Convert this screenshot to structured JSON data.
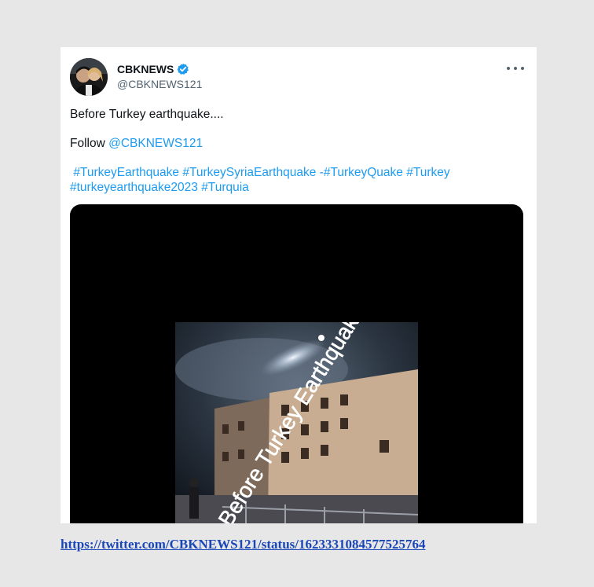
{
  "tweet": {
    "display_name": "CBKNEWS",
    "handle": "@CBKNEWS121",
    "verified_color": "#1d9bf0",
    "text_line1": "Before Turkey earthquake....",
    "follow_prefix": "Follow ",
    "follow_mention": "@CBKNEWS121",
    "hashtags": [
      "#TurkeyEarthquake",
      "#TurkeySyriaEarthquake",
      "#TurkeyQuake",
      "#Turkey",
      "#turkeyearthquake2023",
      "#Turquia"
    ],
    "hashtag_separator_dash": "-",
    "video_overlay_text": "Before Turkey Earthquake",
    "more_icon": "more-horizontal-icon"
  },
  "source_url": "https://twitter.com/CBKNEWS121/status/1623331084577525764",
  "colors": {
    "link": "#1d9bf0",
    "background": "#e8e7e8",
    "url": "#1a47b8"
  }
}
